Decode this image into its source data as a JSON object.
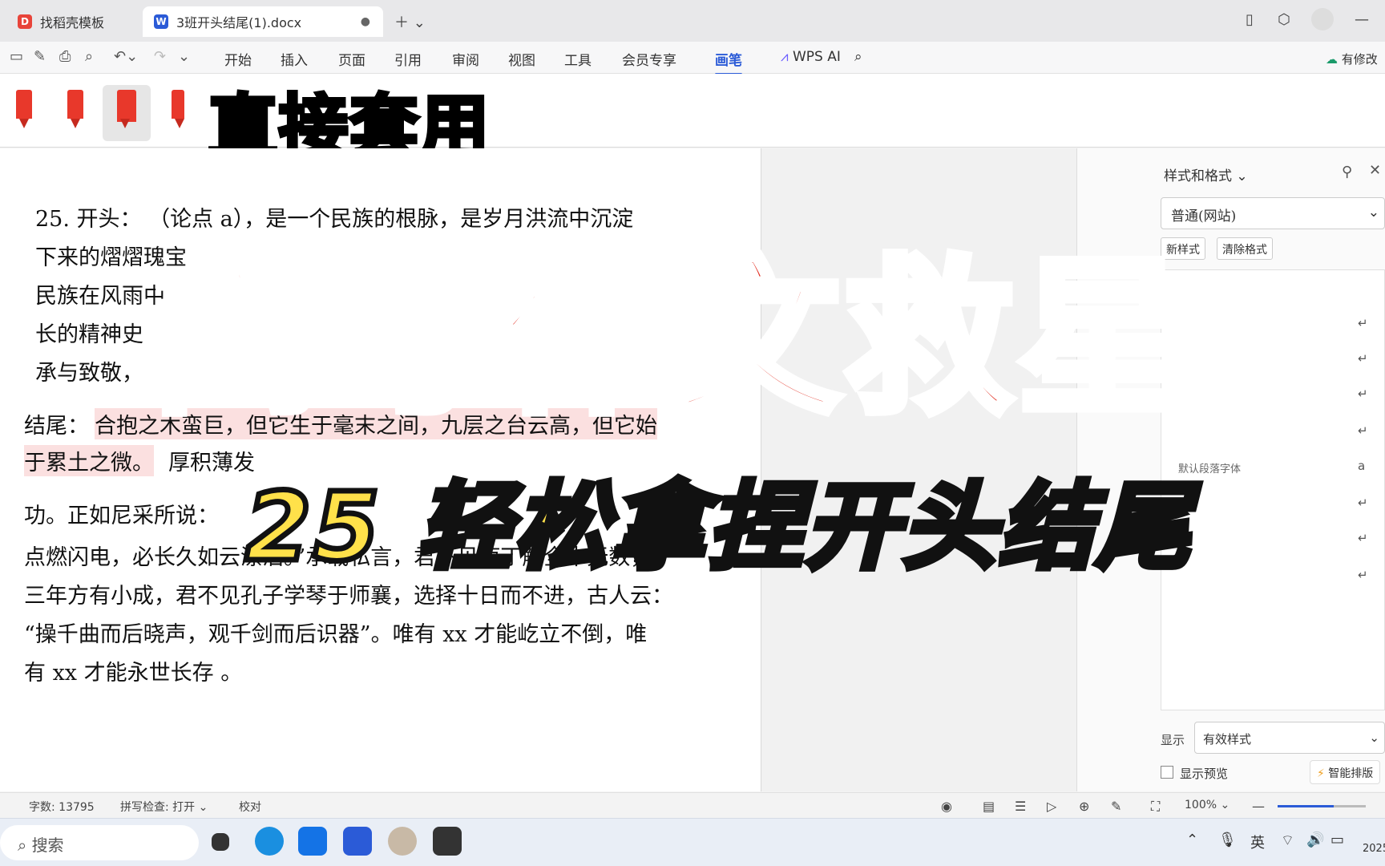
{
  "tabs": [
    {
      "label": "找稻壳模板",
      "icon": "docer-icon"
    },
    {
      "label": "3班开头结尾(1).docx",
      "icon": "wps-word-icon"
    }
  ],
  "menus": [
    "开始",
    "插入",
    "页面",
    "引用",
    "审阅",
    "视图",
    "工具",
    "会员专享",
    "画笔"
  ],
  "active_menu": "画笔",
  "wps_ai": "WPS AI",
  "revise_btn": "有修改",
  "pen_caption": "直接套用",
  "doc": {
    "p1_l1": "25.  开头：  （论点 a），是一个民族的根脉，是岁月洪流中沉淀",
    "p1_l2": "下来的熠熠瑰宝",
    "p1_l3": "民族在风雨中",
    "p1_l4": "长的精神史",
    "p1_l5": "承与致敬，",
    "end_label": "结尾：",
    "end_l1": "合抱之木蛮巨，但它生于毫末之间，九层之台云高，但它始",
    "end_l2a": "于累土之微。",
    "end_l2b": "厚积薄发",
    "end_l3": "功。正如尼采所说：",
    "end_l4": "点燃闪电，必长久如云漂泊。”承载私言，君不见庖丁解全牛无数，",
    "end_l5": "三年方有小成，君不见孔子学琴于师襄，选择十日而不进，古人云：",
    "end_l6": "“操千曲而后晓声，观千剑而后识器”。唯有 xx 才能屹立不倒，唯",
    "end_l7": "有 xx 才能永世长存 。"
  },
  "panel": {
    "title": "样式和格式",
    "current_style": "普通(网站)",
    "new_style": "新样式",
    "clear_format": "清除格式",
    "list_hint": "默认段落字体",
    "show_label": "显示",
    "show_value": "有效样式",
    "preview_label": "显示预览",
    "smart_btn": "智能排版"
  },
  "status": {
    "word_count": "字数: 13795",
    "spell": "拼写检查: 打开",
    "proof": "校对",
    "zoom": "100%"
  },
  "taskbar": {
    "search": "搜索",
    "ime": "英",
    "year": "2025"
  },
  "overlay": {
    "main": "高考作文救星",
    "sub": "25 轻松拿捏开头结尾"
  },
  "colors": {
    "accent": "#2b5bd7",
    "overlay_red": "#e22b1e",
    "overlay_yellow": "#ffe14a",
    "highlight": "#fbe0e0"
  }
}
